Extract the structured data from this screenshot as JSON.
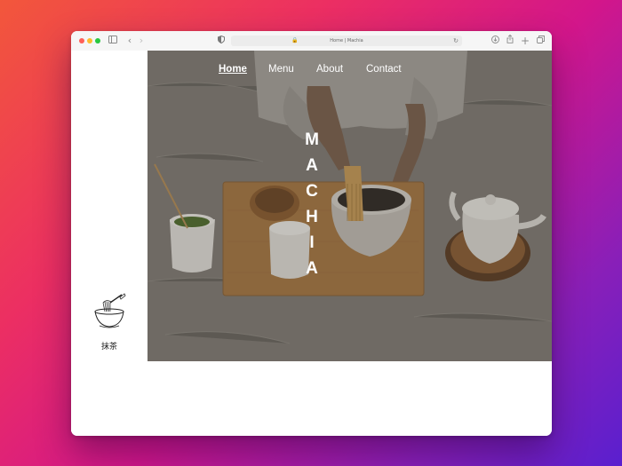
{
  "browser": {
    "address": "Home | Machia"
  },
  "sidebar": {
    "logo_icon": "matcha-bowl-whisk-icon",
    "logo_text": "抹茶"
  },
  "nav": {
    "items": [
      {
        "label": "Home",
        "active": true
      },
      {
        "label": "Menu",
        "active": false
      },
      {
        "label": "About",
        "active": false
      },
      {
        "label": "Contact",
        "active": false
      }
    ]
  },
  "hero": {
    "brand_letters": [
      "M",
      "A",
      "C",
      "H",
      "I",
      "A"
    ]
  },
  "colors": {
    "background_gradient_start": "#f2573b",
    "background_gradient_end": "#5a1fcf",
    "nav_text": "#ffffff",
    "hero_overlay": "#7a756e"
  }
}
